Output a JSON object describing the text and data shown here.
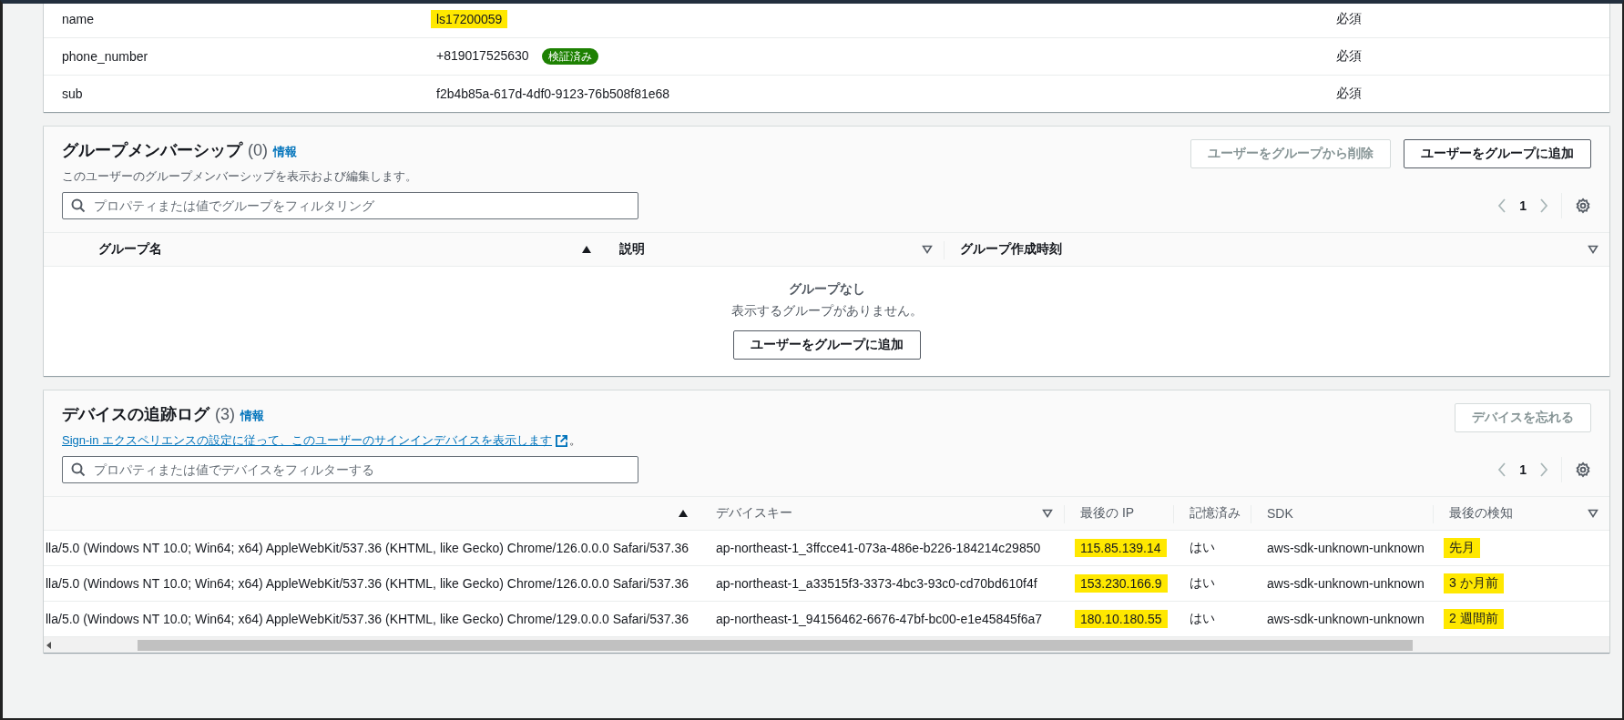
{
  "attributes": {
    "rows": [
      {
        "name": "name",
        "value": "ls17200059",
        "highlighted": true,
        "badge": null,
        "required": "必須"
      },
      {
        "name": "phone_number",
        "value": "+819017525630",
        "highlighted": false,
        "badge": "検証済み",
        "required": "必須"
      },
      {
        "name": "sub",
        "value": "f2b4b85a-617d-4df0-9123-76b508f81e68",
        "highlighted": false,
        "badge": null,
        "required": "必須"
      }
    ]
  },
  "groups": {
    "title": "グループメンバーシップ",
    "count": "(0)",
    "info": "情報",
    "description": "このユーザーのグループメンバーシップを表示および編集します。",
    "buttons": [
      {
        "label": "ユーザーをグループから削除",
        "disabled": true
      },
      {
        "label": "ユーザーをグループに追加",
        "disabled": false
      }
    ],
    "filter": {
      "placeholder": "プロパティまたは値でグループをフィルタリング"
    },
    "page": "1",
    "columns": [
      {
        "label": "グループ名",
        "sorted": true
      },
      {
        "label": "説明",
        "sorted": false
      },
      {
        "label": "グループ作成時刻",
        "sorted": false
      }
    ],
    "empty": {
      "title": "グループなし",
      "text": "表示するグループがありません。",
      "button": "ユーザーをグループに追加"
    }
  },
  "devices": {
    "title": "デバイスの追跡ログ",
    "count": "(3)",
    "info": "情報",
    "link": "Sign-in エクスペリエンスの設定に従って、このユーザーのサインインデバイスを表示します",
    "link_end": "。",
    "button": {
      "label": "デバイスを忘れる",
      "disabled": true
    },
    "filter": {
      "placeholder": "プロパティまたは値でデバイスをフィルターする"
    },
    "page": "1",
    "columns": [
      {
        "sorted": true
      },
      {
        "label": "デバイスキー",
        "sorted": false
      },
      {
        "label": "最後の IP"
      },
      {
        "label": "記憶済み"
      },
      {
        "label": "SDK"
      },
      {
        "label": "最後の検知",
        "sorted": false
      }
    ],
    "rows": [
      {
        "cells": [
          {
            "text": "lla/5.0 (Windows NT 10.0; Win64; x64) AppleWebKit/537.36 (KHTML, like Gecko) Chrome/126.0.0.0 Safari/537.36",
            "highlighted": false
          },
          {
            "text": "ap-northeast-1_3ffcce41-073a-486e-b226-184214c29850",
            "highlighted": false
          },
          {
            "text": "115.85.139.14",
            "highlighted": true
          },
          {
            "text": "はい",
            "highlighted": false
          },
          {
            "text": "aws-sdk-unknown-unknown",
            "highlighted": false
          },
          {
            "text": "先月",
            "highlighted": true
          }
        ]
      },
      {
        "cells": [
          {
            "text": "lla/5.0 (Windows NT 10.0; Win64; x64) AppleWebKit/537.36 (KHTML, like Gecko) Chrome/126.0.0.0 Safari/537.36",
            "highlighted": false
          },
          {
            "text": "ap-northeast-1_a33515f3-3373-4bc3-93c0-cd70bd610f4f",
            "highlighted": false
          },
          {
            "text": "153.230.166.9",
            "highlighted": true
          },
          {
            "text": "はい",
            "highlighted": false
          },
          {
            "text": "aws-sdk-unknown-unknown",
            "highlighted": false
          },
          {
            "text": "3 か月前",
            "highlighted": true
          }
        ]
      },
      {
        "cells": [
          {
            "text": "lla/5.0 (Windows NT 10.0; Win64; x64) AppleWebKit/537.36 (KHTML, like Gecko) Chrome/129.0.0.0 Safari/537.36",
            "highlighted": false
          },
          {
            "text": "ap-northeast-1_94156462-6676-47bf-bc00-e1e45845f6a7",
            "highlighted": false
          },
          {
            "text": "180.10.180.55",
            "highlighted": true
          },
          {
            "text": "はい",
            "highlighted": false
          },
          {
            "text": "aws-sdk-unknown-unknown",
            "highlighted": false
          },
          {
            "text": "2 週間前",
            "highlighted": true
          }
        ]
      }
    ]
  }
}
